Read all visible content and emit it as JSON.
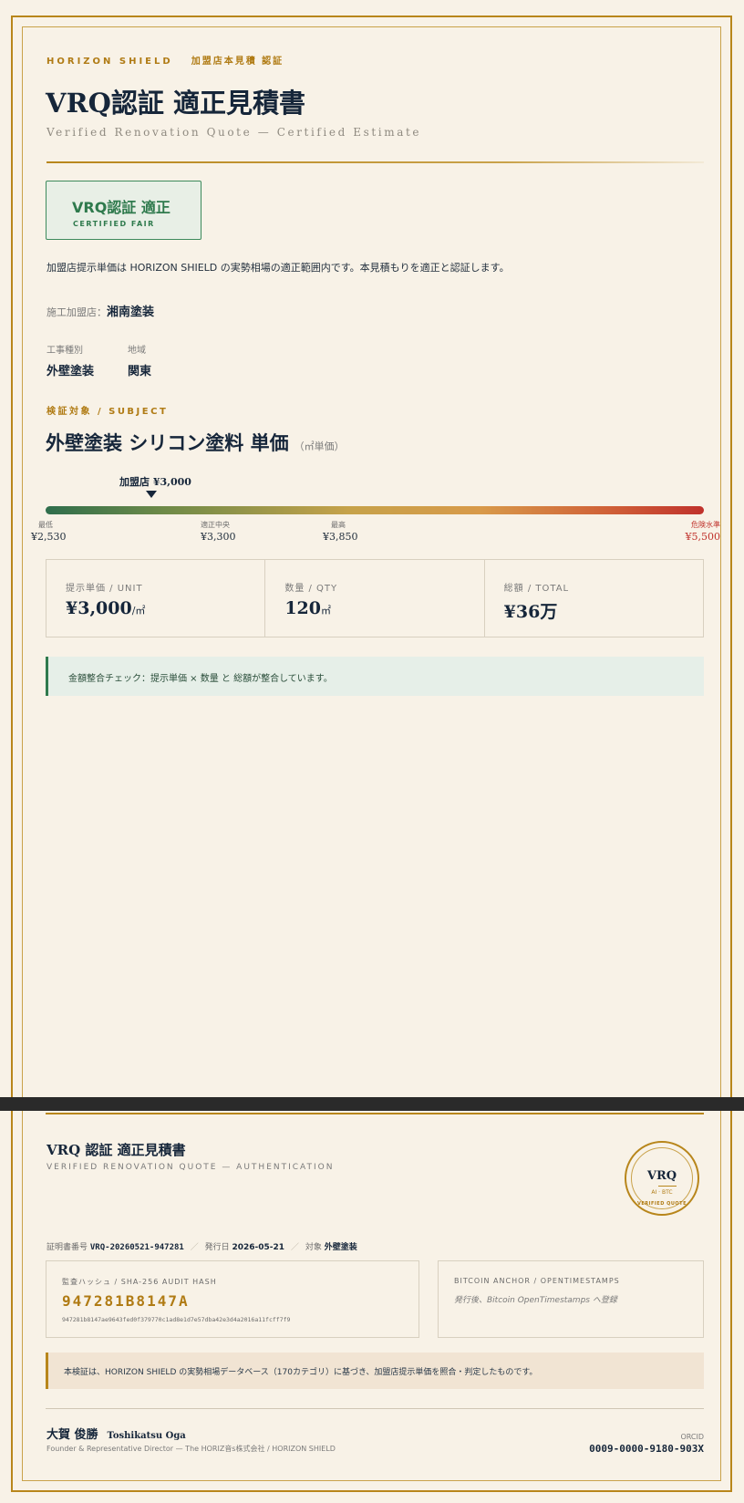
{
  "header": {
    "brand": "HORIZON SHIELD",
    "eyebrow_sub": "加盟店本見積 認証",
    "title": "VRQ認証 適正見積書",
    "subtitle_en": "Verified Renovation Quote — Certified Estimate"
  },
  "stamp": {
    "title": "VRQ認証 適正",
    "subtitle": "CERTIFIED FAIR"
  },
  "verdict": "加盟店提示単価は HORIZON SHIELD の実勢相場の適正範囲内です。本見積もりを適正と認証します。",
  "shop": {
    "label": "施工加盟店：",
    "name": "湘南塗装"
  },
  "meta": {
    "work_type_label": "工事種別",
    "work_type": "外壁塗装",
    "region_label": "地域",
    "region": "関東"
  },
  "subject": {
    "eyebrow": "検証対象 / SUBJECT",
    "title": "外壁塗装 シリコン塗料 単価",
    "unit": "（㎡単価）"
  },
  "price_scale": {
    "marker_label": "加盟店 ¥3,000",
    "marker_value": 3000,
    "ticks": [
      {
        "label": "最低",
        "value_label": "¥2,530",
        "value": 2530
      },
      {
        "label": "適正中央",
        "value_label": "¥3,300",
        "value": 3300
      },
      {
        "label": "最高",
        "value_label": "¥3,850",
        "value": 3850
      },
      {
        "label": "危険水準",
        "value_label": "¥5,500",
        "value": 5500
      }
    ]
  },
  "cards": {
    "unit_price_label": "提示単価 / UNIT",
    "unit_price": "¥3,000",
    "unit_price_suffix": "/㎡",
    "qty_label": "数量 / QTY",
    "qty": "120",
    "qty_suffix": "㎡",
    "total_label": "総額 / TOTAL",
    "total": "¥36万"
  },
  "check": "金額整合チェック：提示単価 × 数量 と 総額が整合しています。",
  "cert": {
    "title": "VRQ 認証 適正見積書",
    "subtitle": "VERIFIED RENOVATION QUOTE — AUTHENTICATION",
    "number_label": "証明書番号",
    "number": "VRQ-20260521-947281",
    "date_label": "発行日",
    "date": "2026-05-21",
    "target_label": "対象",
    "target": "外壁塗装"
  },
  "seal": {
    "title": "VRQ",
    "line2": "AI · BTC",
    "line3": "VERIFIED QUOTE"
  },
  "hash": {
    "label": "監査ハッシュ / SHA-256 AUDIT HASH",
    "short": "947281B8147A",
    "full": "947281b8147ae9643fed0f379770c1ad8e1d7e57dba42e3d4a2016a11fcff7f9"
  },
  "btc": {
    "label": "BITCOIN ANCHOR / OPENTIMESTAMPS",
    "note": "発行後、Bitcoin OpenTimestamps へ登録"
  },
  "note": "本検証は、HORIZON SHIELD の実勢相場データベース（170カテゴリ）に基づき、加盟店提示単価を照合・判定したものです。",
  "signature": {
    "name": "大賀 俊勝",
    "name_en": "Toshikatsu Oga",
    "role": "Founder & Representative Director — The HORIZ音s株式会社 / HORIZON SHIELD",
    "orcid_label": "ORCID",
    "orcid": "0009-0000-9180-903X"
  },
  "colors": {
    "gold": "#b8861b",
    "navy": "#16263a",
    "green": "#2f7a4d",
    "danger": "#c0322c"
  }
}
